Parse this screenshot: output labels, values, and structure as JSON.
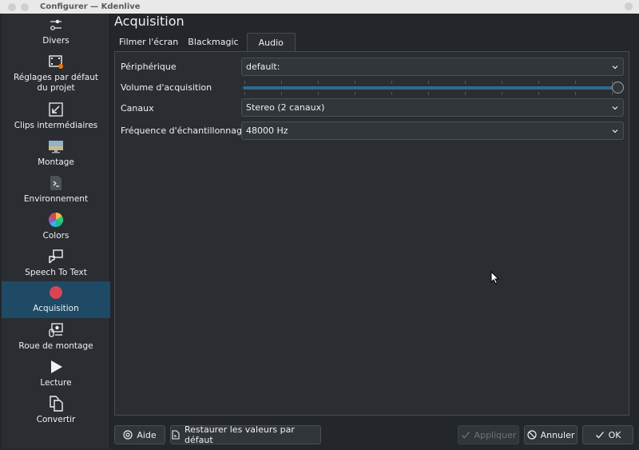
{
  "window": {
    "title": "Configurer — Kdenlive"
  },
  "sidebar": {
    "items": [
      {
        "label": "Divers",
        "icon": "sliders-icon"
      },
      {
        "label": "Réglages par défaut du projet",
        "icon": "film-settings-icon"
      },
      {
        "label": "Clips intermédiaires",
        "icon": "proxy-clips-icon"
      },
      {
        "label": "Montage",
        "icon": "monitor-icon"
      },
      {
        "label": "Environnement",
        "icon": "terminal-icon"
      },
      {
        "label": "Colors",
        "icon": "color-wheel-icon"
      },
      {
        "label": "Speech To Text",
        "icon": "speech-icon"
      },
      {
        "label": "Acquisition",
        "icon": "record-icon",
        "active": true
      },
      {
        "label": "Roue de montage",
        "icon": "jog-shuttle-icon"
      },
      {
        "label": "Lecture",
        "icon": "play-icon"
      },
      {
        "label": "Convertir",
        "icon": "copy-icon"
      }
    ]
  },
  "page": {
    "title": "Acquisition",
    "tabs": [
      {
        "label": "Filmer l'écran"
      },
      {
        "label": "Blackmagic"
      },
      {
        "label": "Audio",
        "active": true
      }
    ]
  },
  "audio": {
    "device_label": "Périphérique",
    "device_value": "default:",
    "volume_label": "Volume d'acquisition",
    "volume_level_percent": 100,
    "channels_label": "Canaux",
    "channels_value": "Stereo (2 canaux)",
    "samplerate_label": "Fréquence d'échantillonnage",
    "samplerate_value": "48000 Hz"
  },
  "buttons": {
    "help": "Aide",
    "restore": "Restaurer les valeurs par défaut",
    "apply": "Appliquer",
    "cancel": "Annuler",
    "ok": "OK"
  },
  "colors": {
    "accent": "#1e4a66",
    "record": "#da4453"
  }
}
